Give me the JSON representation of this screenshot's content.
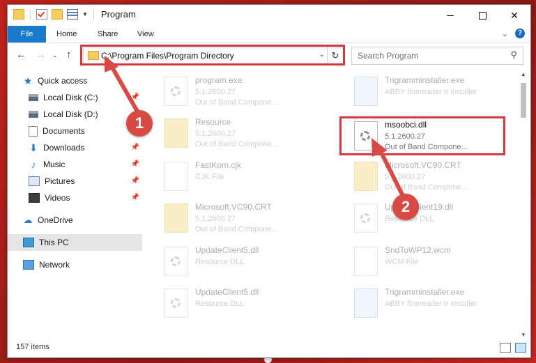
{
  "window": {
    "title": "Program"
  },
  "ribbon": {
    "tabs": [
      "File",
      "Home",
      "Share",
      "View"
    ]
  },
  "nav": {
    "address": "C:\\Program Files\\Program Directory",
    "search_placeholder": "Search Program"
  },
  "sidebar": {
    "items": [
      {
        "label": "Quick access"
      },
      {
        "label": "Local Disk (C:)"
      },
      {
        "label": "Local Disk (D:)"
      },
      {
        "label": "Documents"
      },
      {
        "label": "Downloads"
      },
      {
        "label": "Music"
      },
      {
        "label": "Pictures"
      },
      {
        "label": "Videos"
      },
      {
        "label": "OneDrive"
      },
      {
        "label": "This PC"
      },
      {
        "label": "Network"
      }
    ]
  },
  "files": [
    {
      "name": "program.exe",
      "l2": "5.1.2600.27",
      "l3": "Out of Band Compone..."
    },
    {
      "name": "Trigramminstaller.exe",
      "l2": "ABBY finereader tr installer",
      "l3": ""
    },
    {
      "name": "Resource",
      "l2": "5.1.2600.27",
      "l3": "Out of Band Compone..."
    },
    {
      "name": "msoobci.dll",
      "l2": "5.1.2600.27",
      "l3": "Out of Band Compone..."
    },
    {
      "name": "FastKom.cjk",
      "l2": "CJK File",
      "l3": ""
    },
    {
      "name": "Microsoft.VC90.CRT",
      "l2": "5.1.2600.27",
      "l3": "Out of Band Compone..."
    },
    {
      "name": "Microsoft.VC90.CRT",
      "l2": "5.1.2600.27",
      "l3": "Out of Band Compone..."
    },
    {
      "name": "UpdateClient19.dll",
      "l2": "Resource DLL",
      "l3": ""
    },
    {
      "name": "UpdateClient5.dll",
      "l2": "Resource DLL",
      "l3": ""
    },
    {
      "name": "SndToWP12.wcm",
      "l2": "WCM File",
      "l3": ""
    },
    {
      "name": "UpdateClient5.dll",
      "l2": "Resource DLL",
      "l3": ""
    },
    {
      "name": "Trigramminstaller.exe",
      "l2": "ABBY finereader tr installer",
      "l3": ""
    }
  ],
  "status": {
    "count": "157 items"
  },
  "annotations": {
    "step1": "1",
    "step2": "2"
  },
  "colors": {
    "accent": "#1979ca",
    "annotation": "#d9373f"
  }
}
